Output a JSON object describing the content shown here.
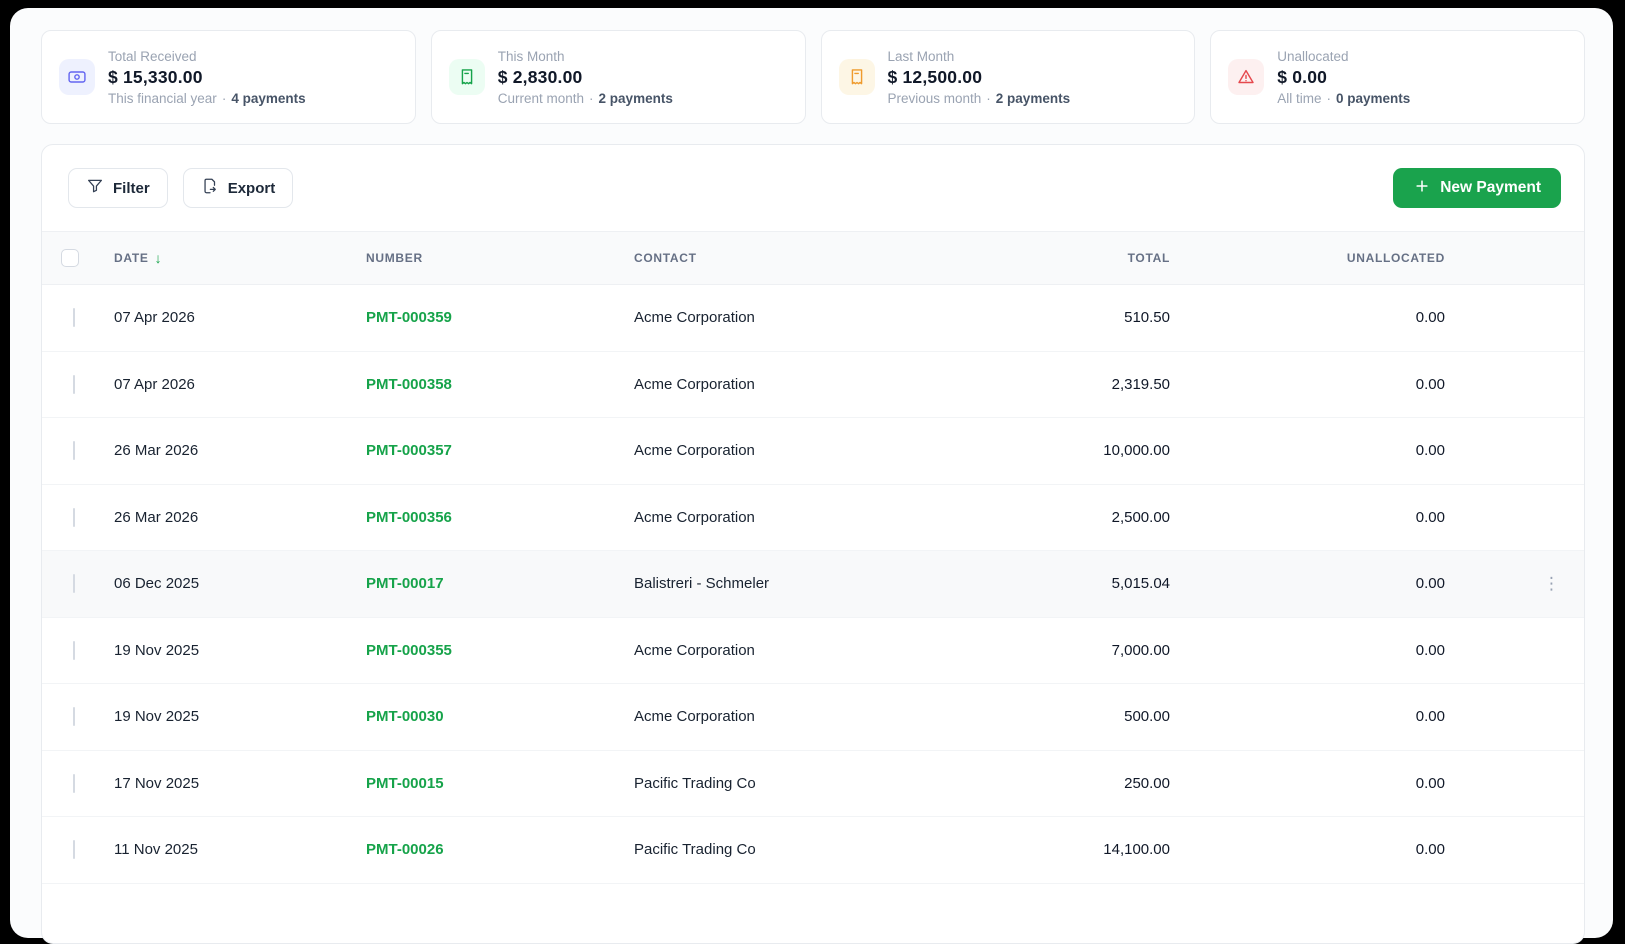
{
  "separator": "·",
  "icons": {
    "sort_desc": "↓",
    "kebab": "⋮"
  },
  "theme": {
    "link_green": "#16a34a",
    "button_green": "#1aa34d",
    "indigo": "#6366f1",
    "orange": "#ef9b2d",
    "red": "#e5484d"
  },
  "stats": [
    {
      "label": "Total Received",
      "value": "$ 15,330.00",
      "period": "This financial year",
      "count": "4 payments",
      "icon": "banknote-icon"
    },
    {
      "label": "This Month",
      "value": "$ 2,830.00",
      "period": "Current month",
      "count": "2 payments",
      "icon": "receipt-icon"
    },
    {
      "label": "Last Month",
      "value": "$ 12,500.00",
      "period": "Previous month",
      "count": "2 payments",
      "icon": "receipt-icon"
    },
    {
      "label": "Unallocated",
      "value": "$ 0.00",
      "period": "All time",
      "count": "0 payments",
      "icon": "warning-icon"
    }
  ],
  "toolbar": {
    "filter_label": "Filter",
    "export_label": "Export",
    "new_payment_label": "New Payment"
  },
  "table": {
    "columns": [
      "DATE",
      "NUMBER",
      "CONTACT",
      "TOTAL",
      "UNALLOCATED"
    ],
    "rows": [
      {
        "date": "07 Apr 2026",
        "number": "PMT-000359",
        "contact": "Acme Corporation",
        "total": "510.50",
        "unallocated": "0.00"
      },
      {
        "date": "07 Apr 2026",
        "number": "PMT-000358",
        "contact": "Acme Corporation",
        "total": "2,319.50",
        "unallocated": "0.00"
      },
      {
        "date": "26 Mar 2026",
        "number": "PMT-000357",
        "contact": "Acme Corporation",
        "total": "10,000.00",
        "unallocated": "0.00"
      },
      {
        "date": "26 Mar 2026",
        "number": "PMT-000356",
        "contact": "Acme Corporation",
        "total": "2,500.00",
        "unallocated": "0.00"
      },
      {
        "date": "06 Dec 2025",
        "number": "PMT-00017",
        "contact": "Balistreri - Schmeler",
        "total": "5,015.04",
        "unallocated": "0.00"
      },
      {
        "date": "19 Nov 2025",
        "number": "PMT-000355",
        "contact": "Acme Corporation",
        "total": "7,000.00",
        "unallocated": "0.00"
      },
      {
        "date": "19 Nov 2025",
        "number": "PMT-00030",
        "contact": "Acme Corporation",
        "total": "500.00",
        "unallocated": "0.00"
      },
      {
        "date": "17 Nov 2025",
        "number": "PMT-00015",
        "contact": "Pacific Trading Co",
        "total": "250.00",
        "unallocated": "0.00"
      },
      {
        "date": "11 Nov 2025",
        "number": "PMT-00026",
        "contact": "Pacific Trading Co",
        "total": "14,100.00",
        "unallocated": "0.00"
      }
    ]
  }
}
